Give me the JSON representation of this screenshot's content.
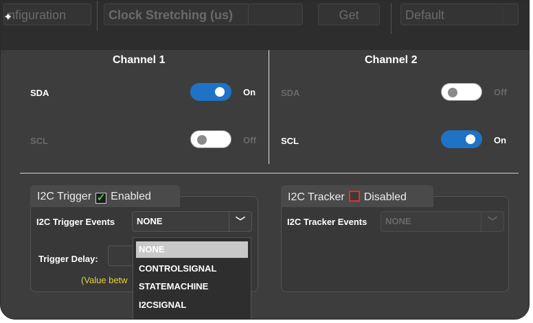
{
  "topbar": {
    "config_label": "nfiguration",
    "clock_label": "Clock Stretching (us)",
    "get_label": "Get",
    "default_label": "Default"
  },
  "channel1": {
    "title": "Channel 1",
    "sda": {
      "label": "SDA",
      "state": "On",
      "enabled": true
    },
    "scl": {
      "label": "SCL",
      "state": "Off",
      "enabled": false
    }
  },
  "channel2": {
    "title": "Channel 2",
    "sda": {
      "label": "SDA",
      "state": "Off",
      "enabled": false
    },
    "scl": {
      "label": "SCL",
      "state": "On",
      "enabled": true
    }
  },
  "trigger": {
    "tab_title": "I2C Trigger",
    "checkbox_label": "Enabled",
    "checked": true,
    "events_label": "I2C Trigger Events",
    "events_value": "NONE",
    "delay_label": "Trigger Delay:",
    "note": "(Value betw",
    "dropdown_options": [
      "NONE",
      "CONTROLSIGNAL",
      "STATEMACHINE",
      "I2CSIGNAL"
    ],
    "dropdown_selected": "NONE"
  },
  "tracker": {
    "tab_title": "I2C Tracker",
    "checkbox_label": "Disabled",
    "checked": false,
    "events_label": "I2C Tracker Events",
    "events_value": "NONE"
  },
  "colors": {
    "background": "#3d3d3d",
    "toggle_on": "#1f73c6",
    "toggle_off": "#ffffff",
    "note_text": "#e6d23a",
    "check_green": "#4ecb58",
    "disabled_box": "#e03131"
  },
  "icons": {
    "gear": "gear-icon",
    "chevron": "chevron-down-icon",
    "check": "check-icon"
  }
}
